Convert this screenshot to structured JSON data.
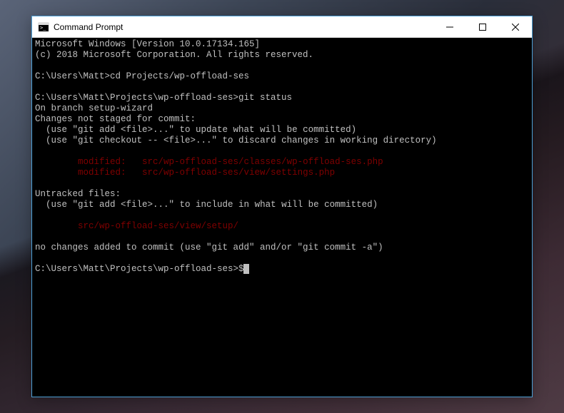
{
  "window": {
    "title": "Command Prompt"
  },
  "terminal": {
    "lines": [
      {
        "t": "Microsoft Windows [Version 10.0.17134.165]",
        "c": ""
      },
      {
        "t": "(c) 2018 Microsoft Corporation. All rights reserved.",
        "c": ""
      },
      {
        "t": "",
        "c": ""
      },
      {
        "t": "C:\\Users\\Matt>cd Projects/wp-offload-ses",
        "c": ""
      },
      {
        "t": "",
        "c": ""
      },
      {
        "t": "C:\\Users\\Matt\\Projects\\wp-offload-ses>git status",
        "c": ""
      },
      {
        "t": "On branch setup-wizard",
        "c": ""
      },
      {
        "t": "Changes not staged for commit:",
        "c": ""
      },
      {
        "t": "  (use \"git add <file>...\" to update what will be committed)",
        "c": ""
      },
      {
        "t": "  (use \"git checkout -- <file>...\" to discard changes in working directory)",
        "c": ""
      },
      {
        "t": "",
        "c": ""
      },
      {
        "t": "        modified:   src/wp-offload-ses/classes/wp-offload-ses.php",
        "c": "red"
      },
      {
        "t": "        modified:   src/wp-offload-ses/view/settings.php",
        "c": "red"
      },
      {
        "t": "",
        "c": ""
      },
      {
        "t": "Untracked files:",
        "c": ""
      },
      {
        "t": "  (use \"git add <file>...\" to include in what will be committed)",
        "c": ""
      },
      {
        "t": "",
        "c": ""
      },
      {
        "t": "        src/wp-offload-ses/view/setup/",
        "c": "red"
      },
      {
        "t": "",
        "c": ""
      },
      {
        "t": "no changes added to commit (use \"git add\" and/or \"git commit -a\")",
        "c": ""
      },
      {
        "t": "",
        "c": ""
      }
    ],
    "prompt": "C:\\Users\\Matt\\Projects\\wp-offload-ses>$"
  }
}
